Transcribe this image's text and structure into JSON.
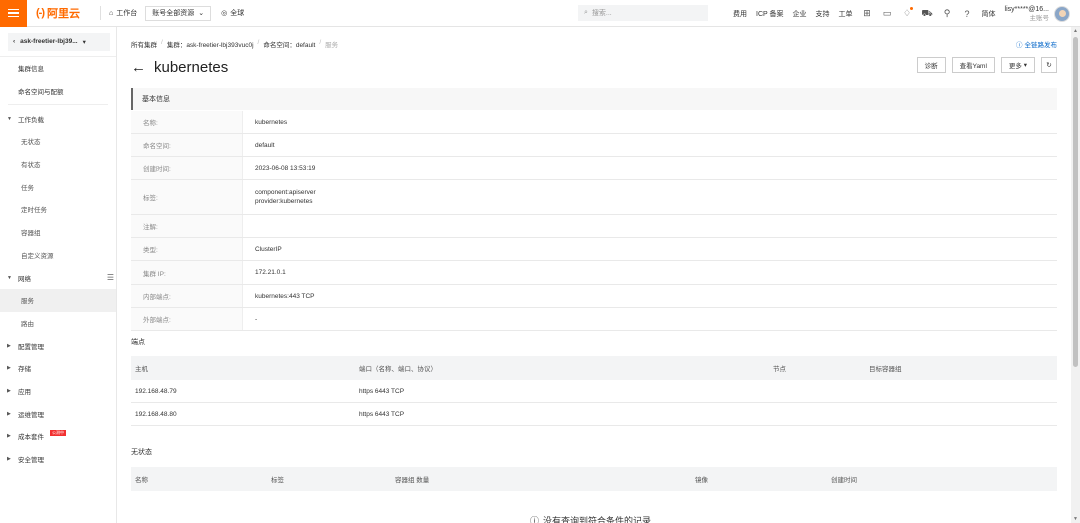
{
  "topbar": {
    "logo": "阿里云",
    "workbench": "工作台",
    "resource_scope": "账号全部资源",
    "region": "全球",
    "search_placeholder": "搜索...",
    "links": [
      "费用",
      "ICP 备案",
      "企业",
      "支持",
      "工单"
    ],
    "lang": "简体",
    "account_name": "lisy*****@16...",
    "account_role": "主账号",
    "accent_color": "#ff6a00"
  },
  "sidebar": {
    "cluster_name": "ask-freetier-lbj39...",
    "items": [
      {
        "label": "集群信息"
      },
      {
        "label": "命名空间与配额"
      }
    ],
    "workload_group": "工作负载",
    "workload_items": [
      "无状态",
      "有状态",
      "任务",
      "定时任务",
      "容器组",
      "自定义资源"
    ],
    "network_group": "网络",
    "network_items": [
      "服务",
      "路由"
    ],
    "groups": [
      "配置管理",
      "存储",
      "应用",
      "运维管理",
      "成本套件",
      "安全管理"
    ],
    "new_badge": "公测中"
  },
  "breadcrumb": {
    "all_clusters": "所有集群",
    "cluster": "集群：ask-freetier-lbj393vuc0j",
    "namespace": "命名空间：default",
    "service": "服务"
  },
  "publish_link": "全链路发布",
  "page": {
    "title": "kubernetes",
    "actions": {
      "diagnose": "诊断",
      "yaml": "查看Yaml",
      "more": "更多"
    }
  },
  "basic_info": {
    "heading": "基本信息",
    "rows": [
      {
        "key": "名称:",
        "value": "kubernetes"
      },
      {
        "key": "命名空间:",
        "value": "default"
      },
      {
        "key": "创建时间:",
        "value": "2023-06-08 13:53:19"
      },
      {
        "key": "标签:",
        "value": "component:apiserver",
        "value2": "provider:kubernetes"
      },
      {
        "key": "注解:",
        "value": ""
      },
      {
        "key": "类型:",
        "value": "ClusterIP"
      },
      {
        "key": "集群 IP:",
        "value": "172.21.0.1"
      },
      {
        "key": "内部端点:",
        "value": "kubernetes:443 TCP"
      },
      {
        "key": "外部端点:",
        "value": "-"
      }
    ]
  },
  "endpoints": {
    "title": "端点",
    "columns": [
      "主机",
      "端口（名称、端口、协议）",
      "节点",
      "目标容器组"
    ],
    "rows": [
      {
        "host": "192.168.48.79",
        "port": "https 6443 TCP",
        "node": "",
        "pod": ""
      },
      {
        "host": "192.168.48.80",
        "port": "https 6443 TCP",
        "node": "",
        "pod": ""
      }
    ]
  },
  "stateless": {
    "title": "无状态",
    "columns": [
      "名称",
      "标签",
      "容器组 数量",
      "镜像",
      "创建时间"
    ],
    "empty": "没有查询到符合条件的记录"
  }
}
